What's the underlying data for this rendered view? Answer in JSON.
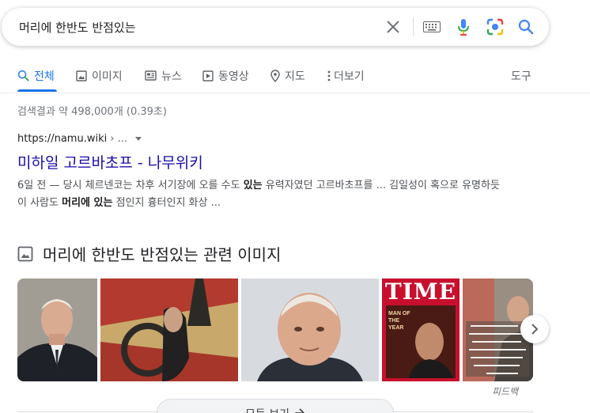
{
  "search": {
    "query": "머리에 한반도 반점있는"
  },
  "tabs": [
    {
      "label": "전체"
    },
    {
      "label": "이미지"
    },
    {
      "label": "뉴스"
    },
    {
      "label": "동영상"
    },
    {
      "label": "지도"
    },
    {
      "label": "더보기"
    }
  ],
  "tools_label": "도구",
  "result_stats": "검색결과 약 498,000개 (0.39초)",
  "result": {
    "domain": "https://namu.wiki",
    "path": "› ...",
    "title": "미하일 고르바초프 - 나무위키",
    "snippet_part1": "6일 전 — 당시 체르넨코는 차후 서기장에 오를 수도 ",
    "snippet_bold1": "있는",
    "snippet_part2": " 유력자였던 고르바초프를 ... 김일성이 혹으로 유명하듯 이 사람도 ",
    "snippet_bold2": "머리에 있는",
    "snippet_part3": " 점인지 흉터인지 화상 ..."
  },
  "images": {
    "header": "머리에 한반도 반점있는 관련 이미지",
    "time_logo": "TIME",
    "time_cover_text": "MAN OF THE YEAR",
    "feedback": "피드백",
    "view_all": "모든 보기"
  },
  "colors": {
    "link": "#1a0dab",
    "accent": "#1a73e8",
    "time_red": "#c8102e"
  },
  "icons": {
    "clear": "close-icon",
    "keyboard": "keyboard-icon",
    "voice": "microphone-icon",
    "lens": "camera-lens-icon",
    "search": "search-icon"
  }
}
